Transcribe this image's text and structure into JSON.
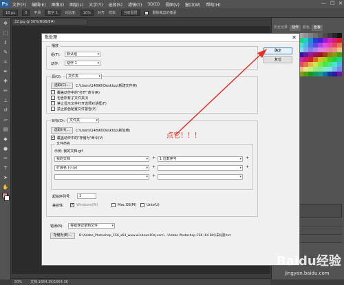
{
  "app": {
    "logo": "Ps",
    "menu": [
      "文件(F)",
      "编辑(E)",
      "图像(I)",
      "图层(L)",
      "文字(Y)",
      "选择(S)",
      "滤镜(T)",
      "3D(D)",
      "视图(V)",
      "窗口(W)",
      "帮助(H)"
    ],
    "window_controls": [
      "—",
      "❐",
      "✕"
    ]
  },
  "options_bar": {
    "size_value": "18 px",
    "size_box": "0",
    "mode_label": "平滑",
    "mode_value": "数字 1",
    "contrast_label": "对比度:",
    "contrast_value": "10%",
    "align_label": "对齐",
    "source_label": "样本:",
    "source_value": "当前图层",
    "check_label": "删除裁剪的像素"
  },
  "document": {
    "tab": "22.jpg @ 50%(RGB/8#)",
    "status_zoom": "50%",
    "status_doc": "文档:1664.3K/1664.3K"
  },
  "right_panel": {
    "tabs": [
      "历史记录",
      "动作",
      "颜色",
      "色板"
    ]
  },
  "dialog": {
    "title": "批处理",
    "close": "✕",
    "ok": "确定",
    "reset": "复位",
    "play": {
      "legend": "播放",
      "set_label": "组(T):",
      "set_value": "默认组",
      "action_label": "动作:",
      "action_value": "动作 1"
    },
    "source": {
      "legend": "源(O):",
      "value": "文件夹",
      "choose_button": "选取(C)...",
      "path": "C:\\Users\\14890\\Desktop\\新建文件夹\\",
      "options": [
        {
          "label": "覆盖动作中的\"打开\"命令(R)",
          "checked": false
        },
        {
          "label": "包含所有子文件夹(I)",
          "checked": false
        },
        {
          "label": "禁止显示文件打开选项对话框(F)",
          "checked": false
        },
        {
          "label": "禁止颜色配置文件警告(P)",
          "checked": false
        }
      ]
    },
    "destination": {
      "legend": "目标(D):",
      "value": "文件夹",
      "choose_button": "选取(H)...",
      "path": "C:\\Users\\14890\\Desktop\\新加坡\\",
      "override_label": "覆盖动作中的\"存储为\"命令(V)",
      "override_checked": true,
      "naming_legend": "文件命名",
      "example": "示例: 我的文档.gif",
      "naming_rows": [
        {
          "left": "我的文档",
          "right": "1 位数序号"
        },
        {
          "left": "扩展名 (小写)",
          "right": ""
        },
        {
          "left": "",
          "right": ""
        }
      ],
      "start_serial_label": "起始序列号:",
      "start_serial_value": "1",
      "compat_label": "兼容性:",
      "compat": [
        {
          "label": "Windows(W)",
          "checked": true
        },
        {
          "label": "Mac OS(M)",
          "checked": false
        },
        {
          "label": "Unix(U)",
          "checked": false
        }
      ]
    },
    "errors": {
      "label": "错误(B):",
      "value": "将错误记录到文件",
      "save_as_button": "存储为(E)...",
      "path": "D:\\Adobe_Photoshop_CS6_x64_www.windows10zj.com\\...\\Adobe Photoshop CS6 (64 Bit)\\未标题.txt"
    }
  },
  "annotation": {
    "text": "点它！！！",
    "color": "#e0302a"
  },
  "watermark": {
    "logo": "Baidu经验",
    "url": "jingyan.baidu.com"
  }
}
